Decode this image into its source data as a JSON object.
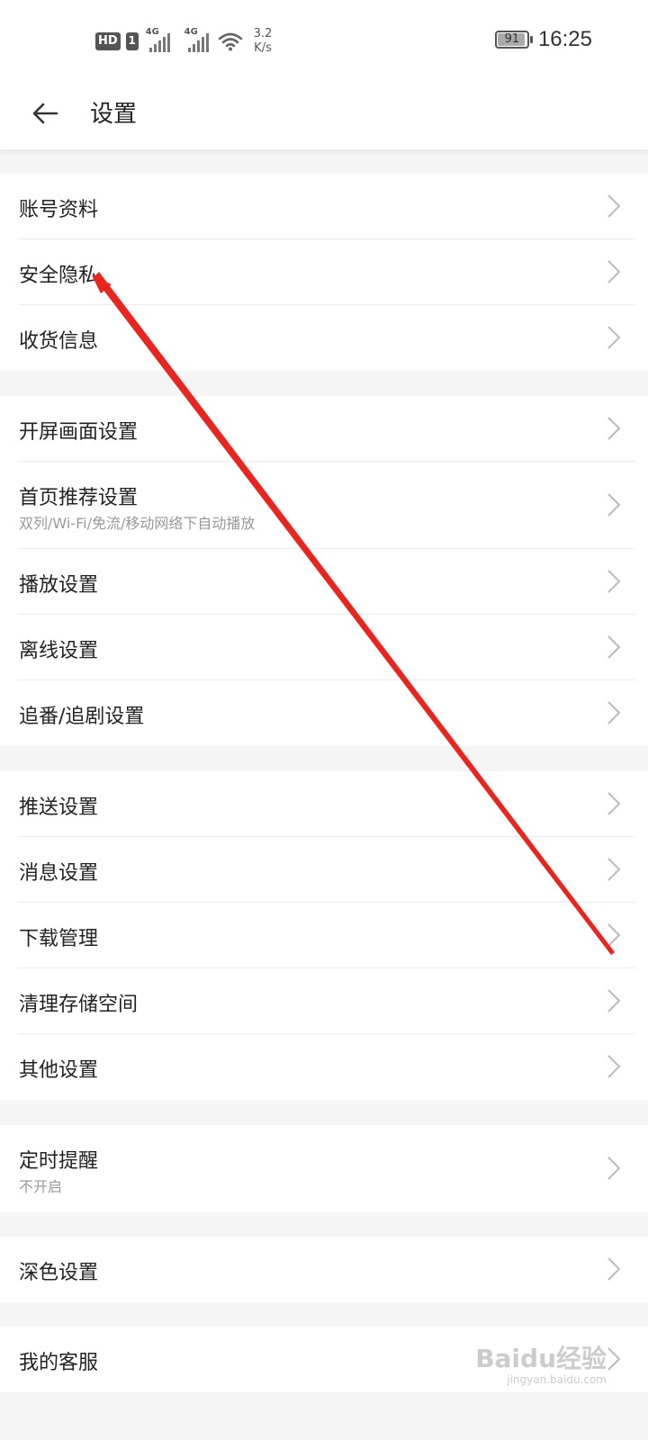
{
  "status_bar": {
    "hd": "HD",
    "sim": "1",
    "net1": "4G",
    "net2": "4G",
    "speed_value": "3.2",
    "speed_unit": "K/s",
    "battery": "91",
    "time": "16:25"
  },
  "header": {
    "title": "设置"
  },
  "groups": [
    {
      "items": [
        {
          "label": "账号资料"
        },
        {
          "label": "安全隐私"
        },
        {
          "label": "收货信息"
        }
      ]
    },
    {
      "items": [
        {
          "label": "开屏画面设置"
        },
        {
          "label": "首页推荐设置",
          "sub": "双列/Wi-Fi/免流/移动网络下自动播放"
        },
        {
          "label": "播放设置"
        },
        {
          "label": "离线设置"
        },
        {
          "label": "追番/追剧设置"
        }
      ]
    },
    {
      "items": [
        {
          "label": "推送设置"
        },
        {
          "label": "消息设置"
        },
        {
          "label": "下载管理"
        },
        {
          "label": "清理存储空间"
        },
        {
          "label": "其他设置"
        }
      ]
    },
    {
      "items": [
        {
          "label": "定时提醒",
          "sub": "不开启"
        }
      ]
    },
    {
      "items": [
        {
          "label": "深色设置"
        }
      ]
    },
    {
      "items": [
        {
          "label": "我的客服"
        }
      ]
    }
  ],
  "watermark": {
    "logo": "Baidu经验",
    "url": "jingyan.baidu.com"
  },
  "colors": {
    "background": "#f5f5f5",
    "row": "#ffffff",
    "text": "#222222",
    "subtext": "#999999",
    "chevron": "#bbbbbb",
    "annotation": "#e8251f"
  }
}
